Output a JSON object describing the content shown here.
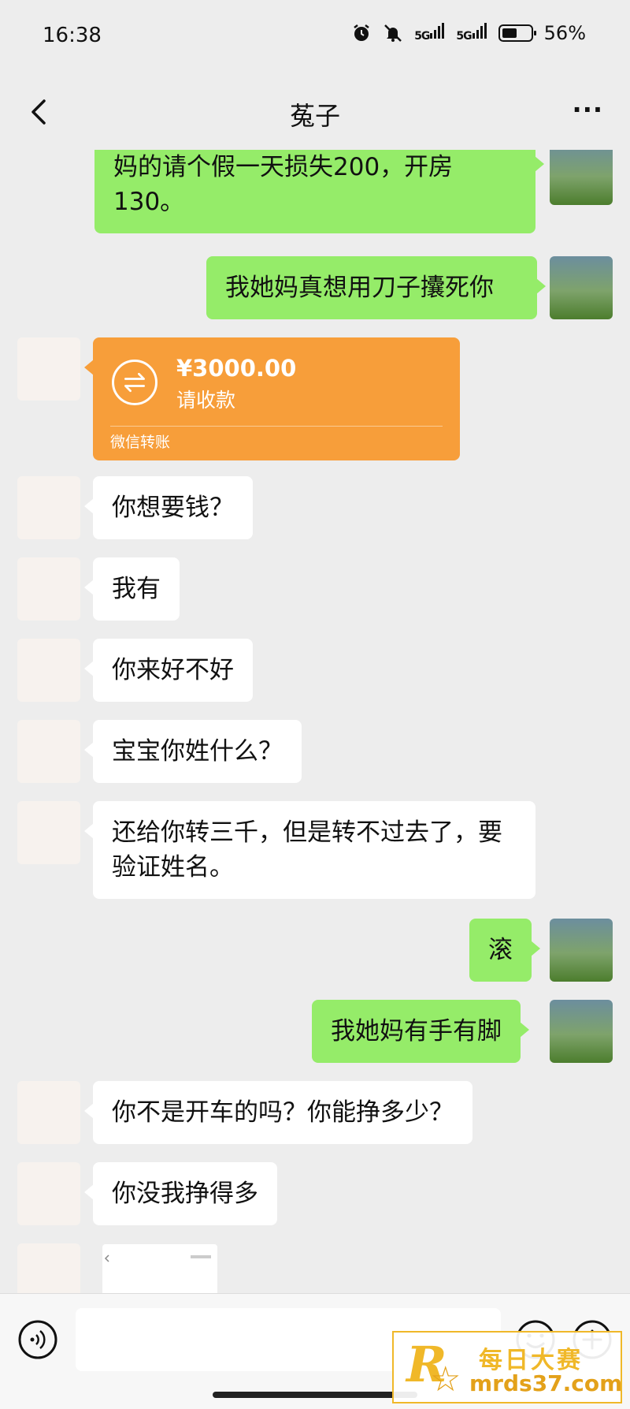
{
  "status_bar": {
    "time": "16:38",
    "network_1": "5G",
    "network_2": "5G",
    "battery": "56%",
    "battery_level": 0.56
  },
  "header": {
    "title": "菟子",
    "more_label": "···"
  },
  "messages": [
    {
      "from": "self",
      "type": "text",
      "text": "妈的请个假一天损失200，开房130。"
    },
    {
      "from": "self",
      "type": "text",
      "text": "我她妈真想用刀子攮死你"
    },
    {
      "from": "other",
      "type": "transfer",
      "amount": "¥3000.00",
      "status": "请收款",
      "footer": "微信转账"
    },
    {
      "from": "other",
      "type": "text",
      "text": "你想要钱？"
    },
    {
      "from": "other",
      "type": "text",
      "text": "我有"
    },
    {
      "from": "other",
      "type": "text",
      "text": "你来好不好"
    },
    {
      "from": "other",
      "type": "text",
      "text": "宝宝你姓什么？"
    },
    {
      "from": "other",
      "type": "text",
      "text": "还给你转三千，但是转不过去了，要验证姓名。"
    },
    {
      "from": "self",
      "type": "text",
      "text": "滚"
    },
    {
      "from": "self",
      "type": "text",
      "text": "我她妈有手有脚"
    },
    {
      "from": "other",
      "type": "text",
      "text": "你不是开车的吗？你能挣多少？"
    },
    {
      "from": "other",
      "type": "text",
      "text": "你没我挣得多"
    },
    {
      "from": "other",
      "type": "image"
    }
  ],
  "input_bar": {
    "placeholder": ""
  },
  "watermark": {
    "chinese": "每日大赛",
    "url": "mrds37.com",
    "logo_letter": "R"
  },
  "colors": {
    "background": "#ededed",
    "self_bubble": "#95ec69",
    "other_bubble": "#ffffff",
    "transfer": "#f79e3a",
    "watermark": "#f0b829"
  }
}
